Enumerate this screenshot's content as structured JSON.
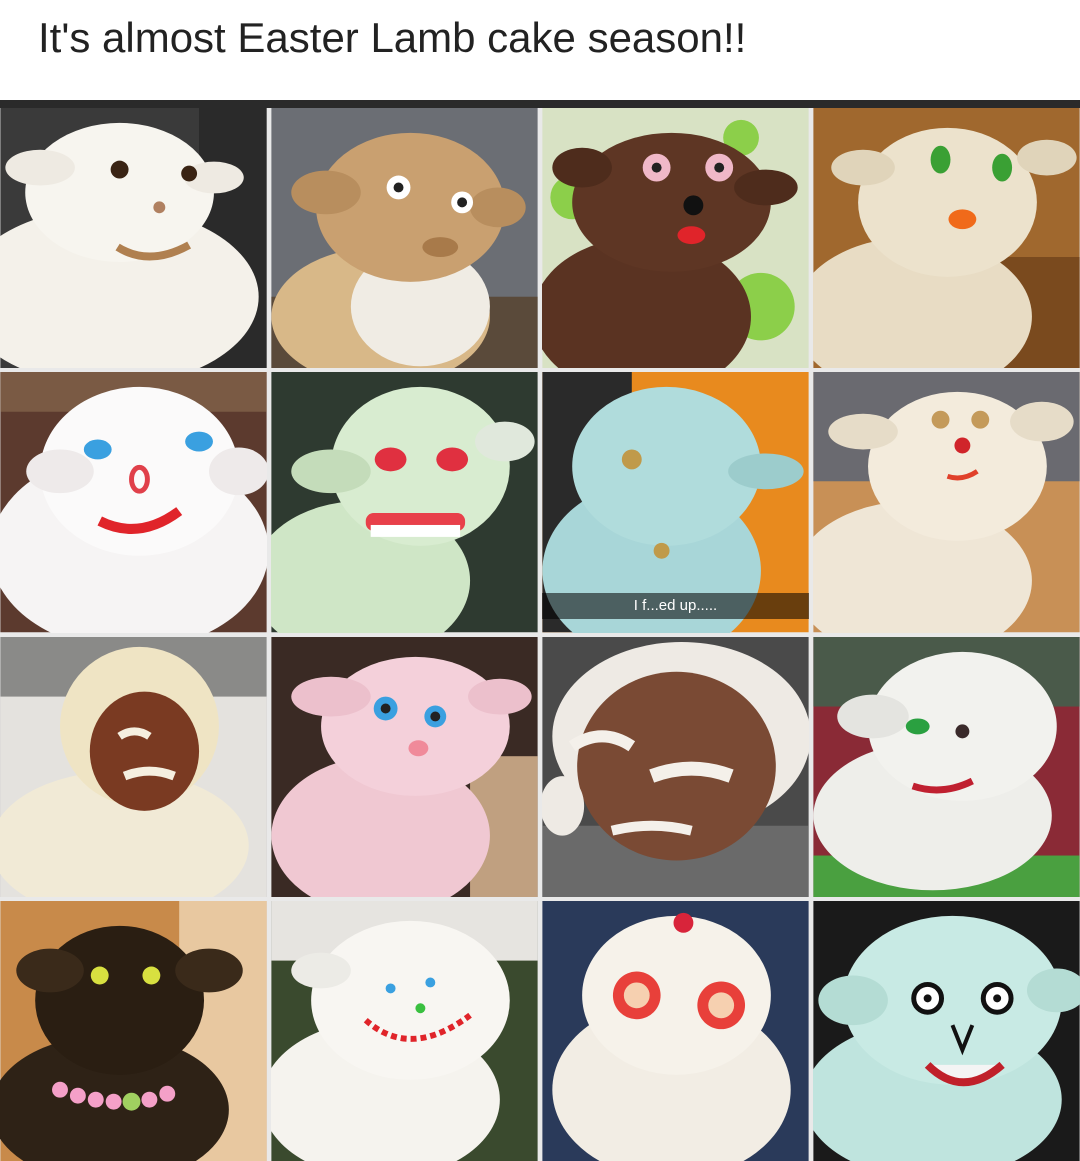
{
  "post": {
    "caption": "It's almost Easter Lamb cake season!!"
  },
  "tiles": [
    {
      "subject": "white-frosted-lamb-cake",
      "frosting": "#f4f1ea",
      "background": "#3a3a3a"
    },
    {
      "subject": "crumbly-tan-lamb-cake",
      "frosting": "#c9a070",
      "background": "#6b6e74"
    },
    {
      "subject": "chocolate-lamb-cake",
      "frosting": "#5a3322",
      "background": "#d8e2c4"
    },
    {
      "subject": "cream-lamb-cake-green-eyes",
      "frosting": "#e8dcc4",
      "background": "#a0682e"
    },
    {
      "subject": "white-lamb-cake-blue-eyes",
      "frosting": "#f6f4f4",
      "background": "#5c3a2e"
    },
    {
      "subject": "green-lamb-cake-red-eyes",
      "frosting": "#cfe6c6",
      "background": "#2e3a30"
    },
    {
      "subject": "blue-lamb-cake",
      "frosting": "#a8d6d8",
      "background": "#e88a1e",
      "overlay_text": "I f...ed up....."
    },
    {
      "subject": "ivory-lamb-cake",
      "frosting": "#efe6d6",
      "background": "#c89056"
    },
    {
      "subject": "brown-face-lamb-cake",
      "frosting": "#f1ead6",
      "background": "#8a8a88"
    },
    {
      "subject": "pink-coconut-lamb-cake",
      "frosting": "#f0c8d2",
      "background": "#3a2a24"
    },
    {
      "subject": "brown-ball-lamb-cake",
      "frosting": "#7a4a34",
      "background": "#4a4a4a"
    },
    {
      "subject": "coconut-lamb-cake-on-grass",
      "frosting": "#eeeeea",
      "background": "#8a2a36"
    },
    {
      "subject": "dark-chocolate-lamb-cake",
      "frosting": "#2e2216",
      "background": "#c88a4a"
    },
    {
      "subject": "white-coconut-lamb-cake",
      "frosting": "#f5f3ee",
      "background": "#3a4a2e"
    },
    {
      "subject": "strawberry-eye-lamb-cake",
      "frosting": "#f2ede4",
      "background": "#2a3a5a"
    },
    {
      "subject": "mint-lamb-cake",
      "frosting": "#bfe4de",
      "background": "#1a1a1a"
    }
  ]
}
